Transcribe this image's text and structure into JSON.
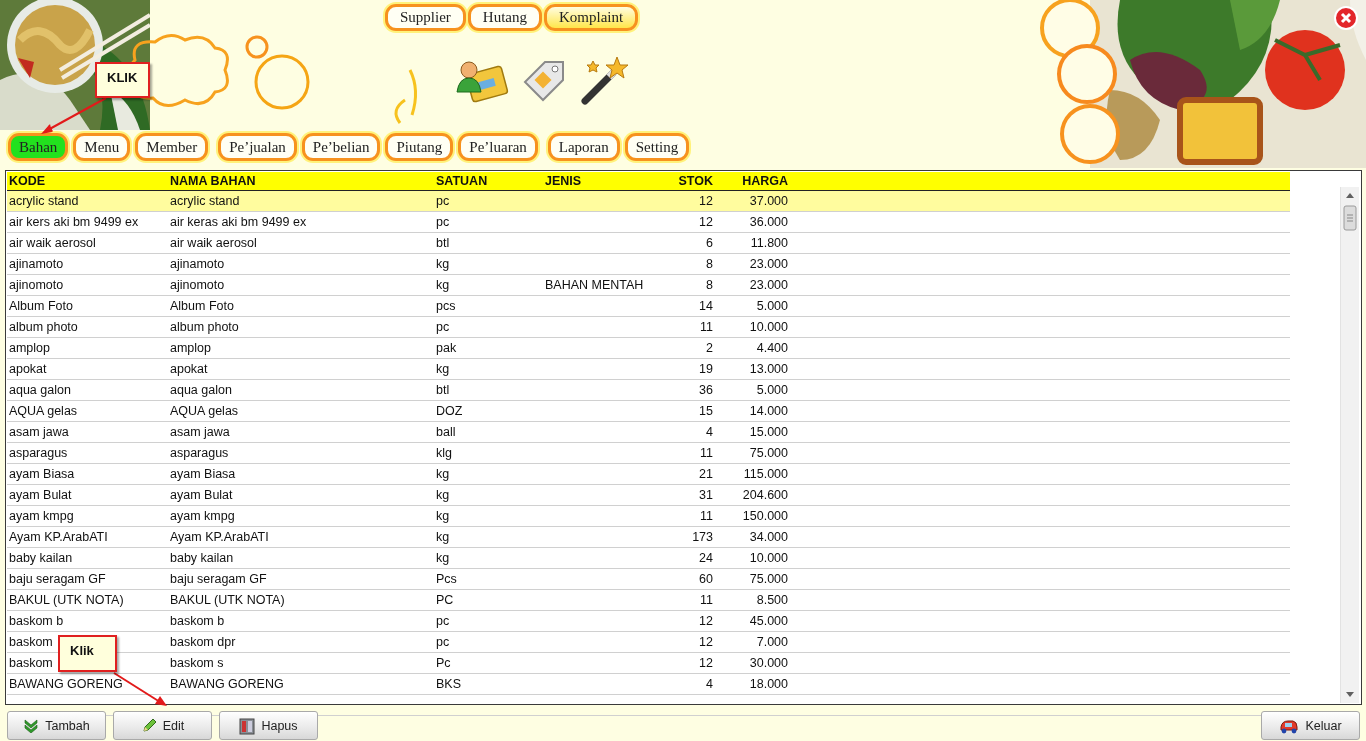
{
  "top_buttons": [
    {
      "label": "Supplier",
      "selected": false
    },
    {
      "label": "Hutang",
      "selected": false
    },
    {
      "label": "Komplaint",
      "selected": true
    }
  ],
  "nav_groups": [
    [
      {
        "label": "Bahan",
        "selected": true
      },
      {
        "label": "Menu",
        "selected": false
      },
      {
        "label": "Member",
        "selected": false
      }
    ],
    [
      {
        "label": "Pe’jualan",
        "selected": false
      },
      {
        "label": "Pe’belian",
        "selected": false
      },
      {
        "label": "Piutang",
        "selected": false
      },
      {
        "label": "Pe’luaran",
        "selected": false
      }
    ],
    [
      {
        "label": "Laporan",
        "selected": false
      },
      {
        "label": "Setting",
        "selected": false
      }
    ]
  ],
  "table": {
    "columns": [
      {
        "label": "KODE",
        "kind": "text"
      },
      {
        "label": "NAMA BAHAN",
        "kind": "text"
      },
      {
        "label": "SATUAN",
        "kind": "text"
      },
      {
        "label": "JENIS",
        "kind": "text"
      },
      {
        "label": "STOK",
        "kind": "number"
      },
      {
        "label": "HARGA",
        "kind": "number"
      }
    ],
    "rows": [
      {
        "kode": "acrylic stand",
        "nama_bahan": "acrylic stand",
        "satuan": "pc",
        "stok": "12",
        "harga": "37.000",
        "selected": true
      },
      {
        "kode": "air kers aki bm 9499 ex",
        "nama_bahan": "air keras aki bm 9499 ex",
        "satuan": "pc",
        "stok": "12",
        "harga": "36.000",
        "selected": false
      },
      {
        "kode": "air waik aerosol",
        "nama_bahan": "air waik aerosol",
        "satuan": "btl",
        "stok": "6",
        "harga": "11.800",
        "selected": false
      },
      {
        "kode": "ajinamoto",
        "nama_bahan": "ajinamoto",
        "satuan": "kg",
        "stok": "8",
        "harga": "23.000",
        "selected": false
      },
      {
        "kode": "ajinomoto",
        "nama_bahan": "ajinomoto",
        "satuan": "kg",
        "jenis": "BAHAN MENTAH",
        "stok": "8",
        "harga": "23.000",
        "selected": false
      },
      {
        "kode": "Album Foto",
        "nama_bahan": "Album Foto",
        "satuan": "pcs",
        "stok": "14",
        "harga": "5.000",
        "selected": false
      },
      {
        "kode": "album photo",
        "nama_bahan": "album photo",
        "satuan": "pc",
        "stok": "11",
        "harga": "10.000",
        "selected": false
      },
      {
        "kode": "amplop",
        "nama_bahan": "amplop",
        "satuan": "pak",
        "stok": "2",
        "harga": "4.400",
        "selected": false
      },
      {
        "kode": "apokat",
        "nama_bahan": "apokat",
        "satuan": "kg",
        "stok": "19",
        "harga": "13.000",
        "selected": false
      },
      {
        "kode": "aqua galon",
        "nama_bahan": "aqua galon",
        "satuan": "btl",
        "stok": "36",
        "harga": "5.000",
        "selected": false
      },
      {
        "kode": "AQUA gelas",
        "nama_bahan": "AQUA gelas",
        "satuan": "DOZ",
        "stok": "15",
        "harga": "14.000",
        "selected": false
      },
      {
        "kode": "asam jawa",
        "nama_bahan": "asam jawa",
        "satuan": "ball",
        "stok": "4",
        "harga": "15.000",
        "selected": false
      },
      {
        "kode": "asparagus",
        "nama_bahan": "asparagus",
        "satuan": "klg",
        "stok": "11",
        "harga": "75.000",
        "selected": false
      },
      {
        "kode": "ayam Biasa",
        "nama_bahan": "ayam Biasa",
        "satuan": "kg",
        "stok": "21",
        "harga": "115.000",
        "selected": false
      },
      {
        "kode": "ayam Bulat",
        "nama_bahan": "ayam Bulat",
        "satuan": "kg",
        "stok": "31",
        "harga": "204.600",
        "selected": false
      },
      {
        "kode": "ayam kmpg",
        "nama_bahan": "ayam kmpg",
        "satuan": "kg",
        "stok": "11",
        "harga": "150.000",
        "selected": false
      },
      {
        "kode": "Ayam KP.ArabATI",
        "nama_bahan": "Ayam KP.ArabATI",
        "satuan": "kg",
        "stok": "173",
        "harga": "34.000",
        "selected": false
      },
      {
        "kode": "baby kailan",
        "nama_bahan": "baby kailan",
        "satuan": "kg",
        "stok": "24",
        "harga": "10.000",
        "selected": false
      },
      {
        "kode": "baju seragam GF",
        "nama_bahan": "baju seragam GF",
        "satuan": "Pcs",
        "stok": "60",
        "harga": "75.000",
        "selected": false
      },
      {
        "kode": "BAKUL (UTK NOTA)",
        "nama_bahan": "BAKUL (UTK NOTA)",
        "satuan": "PC",
        "stok": "11",
        "harga": "8.500",
        "selected": false
      },
      {
        "kode": "baskom b",
        "nama_bahan": "baskom b",
        "satuan": "pc",
        "stok": "12",
        "harga": "45.000",
        "selected": false
      },
      {
        "kode": "baskom",
        "nama_bahan": "baskom dpr",
        "satuan": "pc",
        "stok": "12",
        "harga": "7.000",
        "selected": false
      },
      {
        "kode": "baskom",
        "nama_bahan": "baskom s",
        "satuan": "Pc",
        "stok": "12",
        "harga": "30.000",
        "selected": false
      },
      {
        "kode": "BAWANG GORENG",
        "nama_bahan": "BAWANG GORENG",
        "satuan": "BKS",
        "stok": "4",
        "harga": "18.000",
        "selected": false
      }
    ]
  },
  "toolbar": {
    "left": [
      {
        "label": "Tambah",
        "kind": "add"
      },
      {
        "label": "Edit",
        "kind": "edit"
      },
      {
        "label": "Hapus",
        "kind": "delete"
      }
    ],
    "right": [
      {
        "label": "Keluar",
        "kind": "exit"
      }
    ]
  },
  "callouts": [
    {
      "text": "KLIK"
    },
    {
      "text": "Klik"
    }
  ]
}
